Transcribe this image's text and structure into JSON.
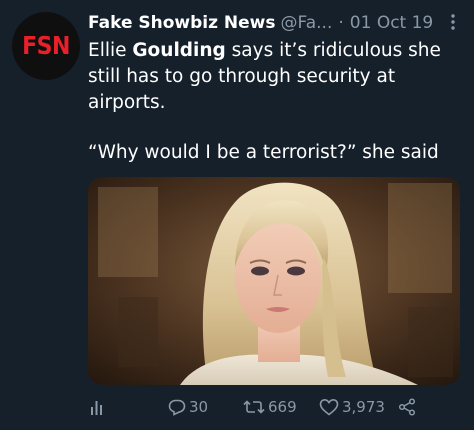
{
  "author": {
    "avatar_text": "FSN",
    "name": "Fake Showbiz News",
    "handle": "@Fa...",
    "separator": "·",
    "date": "01 Oct 19"
  },
  "more_icon": "more-vertical-icon",
  "tweet": {
    "line1_pre": "Ellie ",
    "line1_bold": "Goulding",
    "line1_post": " says it’s ridiculous she still has to go through security at airports.",
    "quote": "“Why would I be a terrorist?” she said"
  },
  "media": {
    "icon": "photo-image"
  },
  "actions": {
    "analytics_icon": "analytics-icon",
    "replies": "30",
    "retweets": "669",
    "likes": "3,973",
    "share_icon": "share-icon"
  },
  "colors": {
    "background": "#15202b",
    "text": "#ffffff",
    "muted": "#8b98a5",
    "avatar_red": "#e8202a"
  }
}
